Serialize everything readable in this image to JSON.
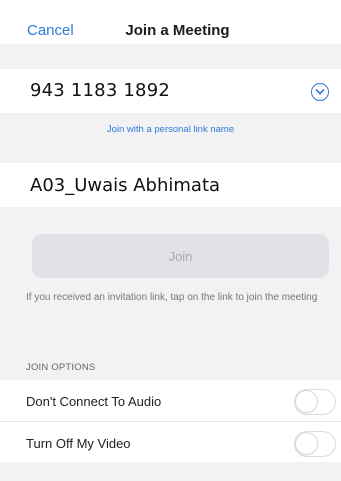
{
  "nav": {
    "cancel_label": "Cancel",
    "title": "Join a Meeting"
  },
  "meeting_id": {
    "value": "943 1183 1892",
    "dropdown_icon": "chevron-down-circle-icon"
  },
  "personal_link": {
    "label": "Join with a personal link name"
  },
  "display_name": {
    "value": "A03_Uwais Abhimata"
  },
  "join_button": {
    "label": "Join"
  },
  "hint": {
    "text": "If you received an invitation link, tap on the link to join the meeting"
  },
  "join_options": {
    "section_title": "JOIN OPTIONS",
    "options": [
      {
        "label": "Don't Connect To Audio",
        "enabled": false
      },
      {
        "label": "Turn Off My Video",
        "enabled": false
      }
    ]
  },
  "colors": {
    "accent": "#2d7bd6",
    "background": "#f2f2f5",
    "button_disabled_bg": "#e2e2e6",
    "button_disabled_text": "#a7a7ad"
  }
}
